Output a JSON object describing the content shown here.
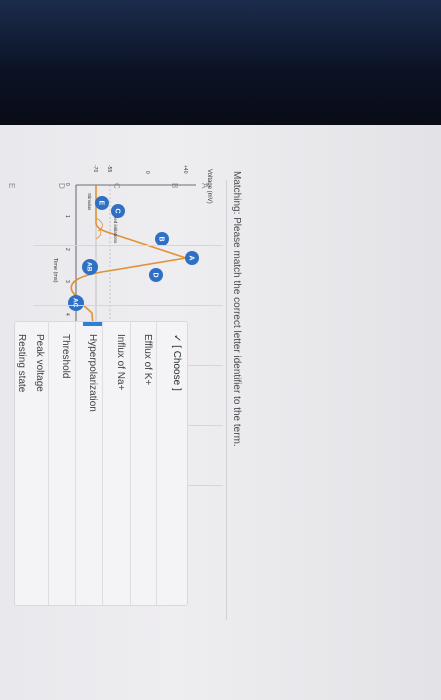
{
  "prompt": "Matching: Please match the correct letter identifier to the term.",
  "letters": [
    "A",
    "B",
    "C",
    "D",
    "E"
  ],
  "dropdown": {
    "selected": "✓ [ Choose ]",
    "options": [
      "Efflux of K+",
      "Influx of Na+",
      "Hyperpolarization",
      "Threshold",
      "Peak voltage",
      "Resting state"
    ]
  },
  "chart": {
    "ylabel": "Voltage (mV)",
    "xlabel": "Time (ms)",
    "yticks": [
      "+40",
      "0",
      "-55",
      "-70"
    ],
    "xticks": [
      "0",
      "1",
      "2",
      "3",
      "4",
      "5"
    ],
    "annotations": [
      "Failed initiations",
      "Stimulus"
    ],
    "markers": [
      "A",
      "B",
      "C",
      "D",
      "E",
      "AB",
      "AC"
    ],
    "colors": {
      "marker": "#2f6fc4",
      "trace": "#e09236"
    }
  },
  "chart_data": {
    "type": "line",
    "xlabel": "Time (ms)",
    "ylabel": "Voltage (mV)",
    "x": [
      0,
      1,
      1.3,
      2,
      2.6,
      3.2,
      4,
      5
    ],
    "y": [
      -70,
      -70,
      -55,
      40,
      -55,
      -85,
      -75,
      -70
    ],
    "ylim": [
      -90,
      50
    ],
    "xlim": [
      0,
      5
    ]
  }
}
